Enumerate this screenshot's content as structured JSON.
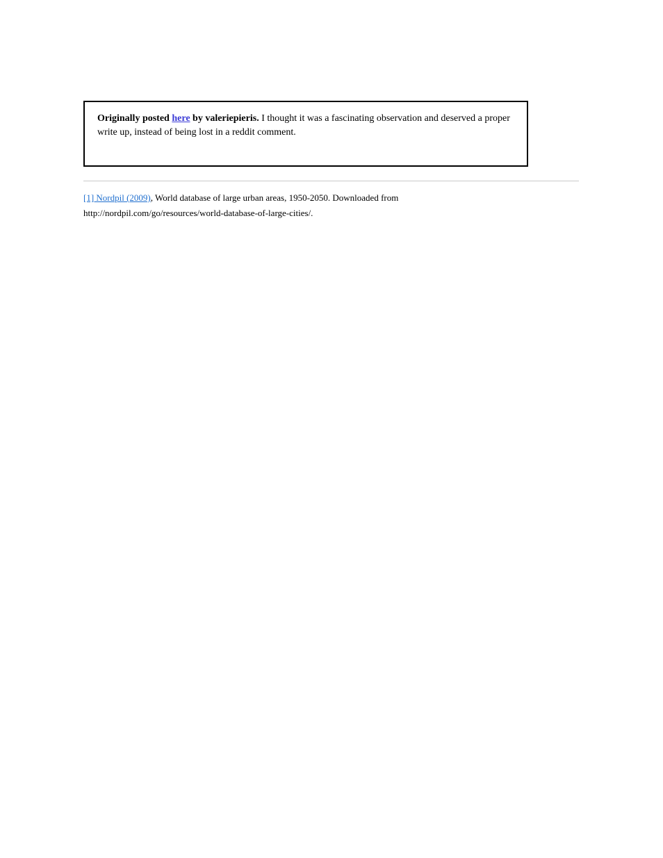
{
  "callout": {
    "prefix": "Originally posted ",
    "link_text": "here",
    "suffix": " by valeriepieris.",
    "body": " I thought it was a fascinating observation and deserved a proper write up, instead of being lost in a reddit comment."
  },
  "references": {
    "line1_link": "[1] Nordpil (2009)",
    "line1_tail": ", World database of large urban areas, 1950-2050. Downloaded from",
    "line2": "http://nordpil.com/go/resources/world-database-of-large-cities/."
  }
}
